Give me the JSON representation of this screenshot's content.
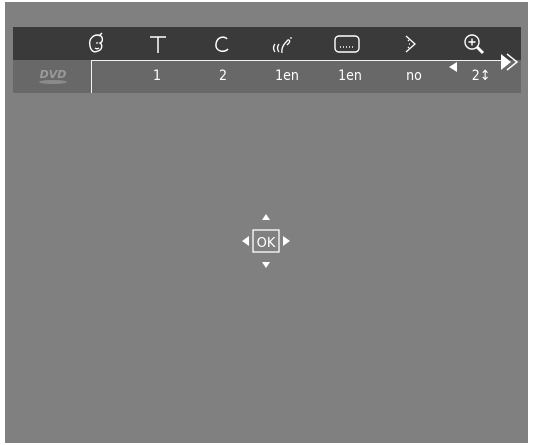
{
  "menu": {
    "source_logo": "DVD",
    "items": [
      {
        "icon": "child-lock-icon",
        "value": ""
      },
      {
        "icon": "title-icon",
        "value": "1"
      },
      {
        "icon": "chapter-icon",
        "value": "2"
      },
      {
        "icon": "audio-language-icon",
        "value": "1en"
      },
      {
        "icon": "subtitle-icon",
        "value": "1en"
      },
      {
        "icon": "angle-icon",
        "value": "no"
      },
      {
        "icon": "zoom-icon",
        "value": "2↕"
      }
    ]
  },
  "nav": {
    "ok_label": "OK"
  },
  "colors": {
    "screen_bg": "#808080",
    "menu_top_bg": "#3a3a3a",
    "menu_bottom_bg": "#686868",
    "foreground": "#ffffff"
  }
}
